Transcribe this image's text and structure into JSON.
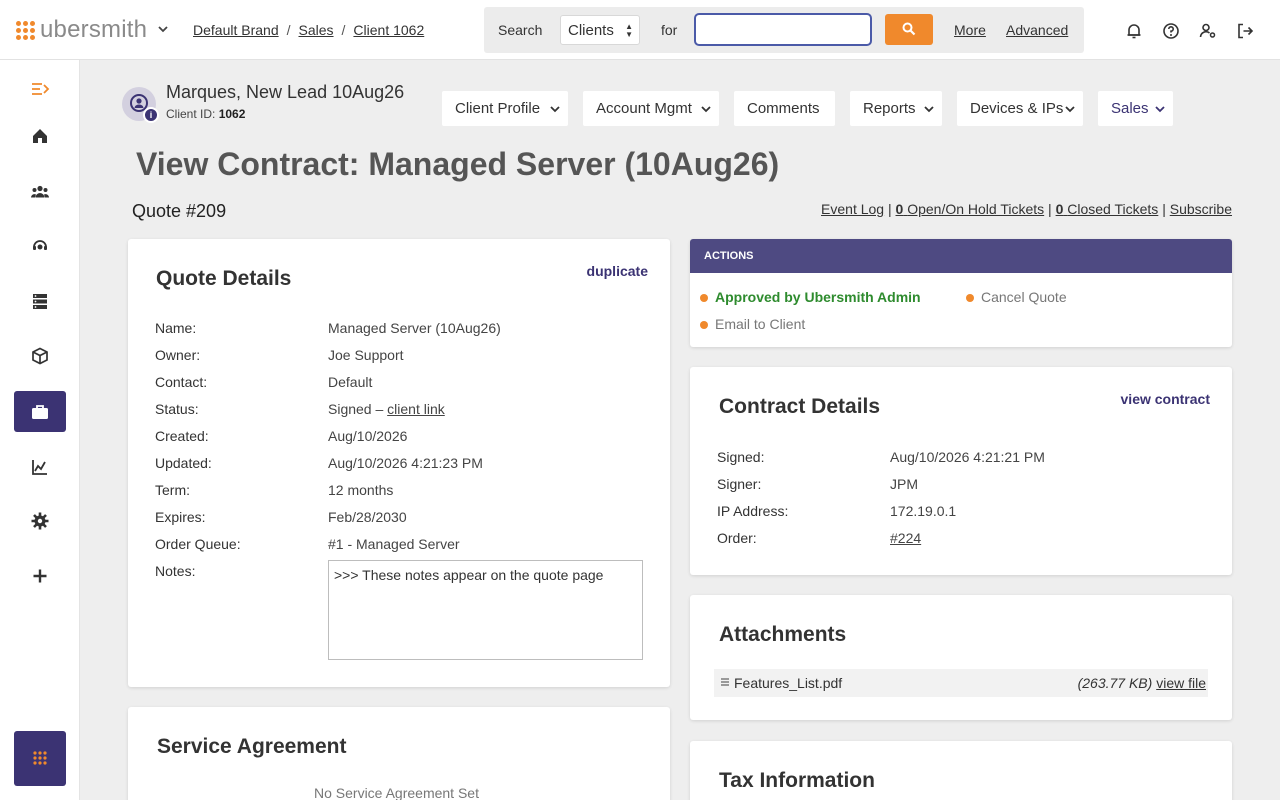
{
  "app": {
    "logo_text": "ubersmith"
  },
  "breadcrumb": {
    "items": [
      "Default Brand",
      "Sales",
      "Client 1062"
    ],
    "separator": "/"
  },
  "search": {
    "label": "Search",
    "scope": "Clients",
    "for_label": "for",
    "query": "",
    "more": "More",
    "advanced": "Advanced"
  },
  "header_icons": [
    "bell-icon",
    "help-icon",
    "user-settings-icon",
    "logout-icon"
  ],
  "sidebar": {
    "items": [
      "menu-toggle-icon",
      "home-icon",
      "clients-icon",
      "support-icon",
      "devices-icon",
      "packages-icon",
      "sales-icon",
      "reports-icon",
      "settings-icon",
      "add-icon",
      "apps-icon"
    ],
    "active": "sales-icon"
  },
  "client": {
    "name": "Marques, New Lead 10Aug26",
    "id_label": "Client ID:",
    "id": "1062"
  },
  "tabs": [
    "Client Profile",
    "Account Mgmt",
    "Comments",
    "Reports",
    "Devices & IPs",
    "Sales"
  ],
  "page": {
    "title": "View Contract: Managed Server (10Aug26)",
    "quote_number": "Quote #209",
    "links": {
      "event_log": "Event Log",
      "open_count": "0",
      "open_label": "Open/On Hold Tickets",
      "closed_count": "0",
      "closed_label": "Closed Tickets",
      "subscribe": "Subscribe",
      "sep": "|"
    }
  },
  "quote_details": {
    "title": "Quote Details",
    "duplicate": "duplicate",
    "rows": [
      {
        "label": "Name:",
        "value": "Managed Server (10Aug26)"
      },
      {
        "label": "Owner:",
        "value": "Joe Support"
      },
      {
        "label": "Contact:",
        "value": "Default"
      },
      {
        "label": "Status:",
        "value": "Signed – ",
        "link": "client link"
      },
      {
        "label": "Created:",
        "value": "Aug/10/2026"
      },
      {
        "label": "Updated:",
        "value": "Aug/10/2026 4:21:23 PM"
      },
      {
        "label": "Term:",
        "value": "12 months"
      },
      {
        "label": "Expires:",
        "value": "Feb/28/2030"
      },
      {
        "label": "Order Queue:",
        "value": "#1 - Managed Server"
      },
      {
        "label": "Notes:",
        "value": ">>> These notes appear on the quote page"
      }
    ]
  },
  "actions": {
    "title": "ACTIONS",
    "items": [
      "Approved by Ubersmith Admin",
      "Cancel Quote",
      "Email to Client"
    ]
  },
  "contract_details": {
    "title": "Contract Details",
    "view_contract": "view contract",
    "rows": [
      {
        "label": "Signed:",
        "value": "Aug/10/2026 4:21:21 PM"
      },
      {
        "label": "Signer:",
        "value": "JPM"
      },
      {
        "label": "IP Address:",
        "value": "172.19.0.1"
      },
      {
        "label": "Order:",
        "value": "#224"
      }
    ]
  },
  "attachments": {
    "title": "Attachments",
    "files": [
      {
        "name": "Features_List.pdf",
        "size": "(263.77 KB)",
        "action": "view file"
      }
    ]
  },
  "service_agreement": {
    "title": "Service Agreement",
    "empty": "No Service Agreement Set"
  },
  "tax_information": {
    "title": "Tax Information"
  },
  "colors": {
    "accent": "#f0892c",
    "brand": "#3b3373",
    "actions_header": "#4e4a82",
    "approved": "#2e8b2e"
  }
}
